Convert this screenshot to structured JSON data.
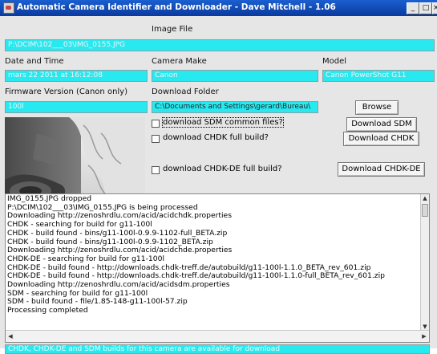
{
  "window": {
    "title": "Automatic Camera Identifier and Downloader - Dave Mitchell - 1.06",
    "minimize": "_",
    "maximize": "□",
    "close": "×"
  },
  "image_file": {
    "label": "Image File",
    "value": "P:\\DCIM\\102___03\\IMG_0155.JPG"
  },
  "date_time": {
    "label": "Date and Time",
    "value": "mars 22 2011 at 16:12:08"
  },
  "camera_make": {
    "label": "Camera Make",
    "value": "Canon"
  },
  "model": {
    "label": "Model",
    "value": "Canon PowerShot G11"
  },
  "firmware": {
    "label": "Firmware Version (Canon only)",
    "value": "100l"
  },
  "download_folder": {
    "label": "Download Folder",
    "value": "C:\\Documents and Settings\\gerard\\Bureau\\"
  },
  "buttons": {
    "browse": "Browse",
    "download_sdm": "Download SDM",
    "download_chdk": "Download CHDK",
    "download_chdk_de": "Download CHDK-DE"
  },
  "checkboxes": {
    "sdm_common": {
      "label": "download SDM common files?",
      "checked": false
    },
    "chdk_full": {
      "label": "download CHDK full build?",
      "checked": false
    },
    "chdk_de_full": {
      "label": "download CHDK-DE full build?",
      "checked": false
    }
  },
  "log": [
    "IMG_0155.JPG dropped",
    "P:\\DCIM\\102___03\\IMG_0155.JPG is being processed",
    "Downloading http://zenoshrdlu.com/acid/acidchdk.properties",
    "CHDK - searching for build for g11-100l",
    "CHDK - build found - bins/g11-100l-0.9.9-1102-full_BETA.zip",
    "CHDK - build found - bins/g11-100l-0.9.9-1102_BETA.zip",
    "Downloading http://zenoshrdlu.com/acid/acidchde.properties",
    "CHDK-DE - searching for build for g11-100l",
    "CHDK-DE - build found - http://downloads.chdk-treff.de/autobuild/g11-100l-1.1.0_BETA_rev_601.zip",
    "CHDK-DE - build found - http://downloads.chdk-treff.de/autobuild/g11-100l-1.1.0-full_BETA_rev_601.zip",
    "Downloading http://zenoshrdlu.com/acid/acidsdm.properties",
    "SDM - searching for build for g11-100l",
    "SDM - build found - file/1.85-148-g11-100l-57.zip",
    "Processing completed"
  ],
  "status": "CHDK, CHDK-DE and SDM builds for this camera are available for download",
  "colors": {
    "field_bg": "#28e9ef",
    "titlebar": "#0a3a9e",
    "window_bg": "#e6e6e6"
  },
  "icons": {
    "app": "camera-app-icon",
    "scroll_up": "arrow-up-icon",
    "scroll_down": "arrow-down-icon",
    "scroll_left": "arrow-left-icon",
    "scroll_right": "arrow-right-icon"
  }
}
